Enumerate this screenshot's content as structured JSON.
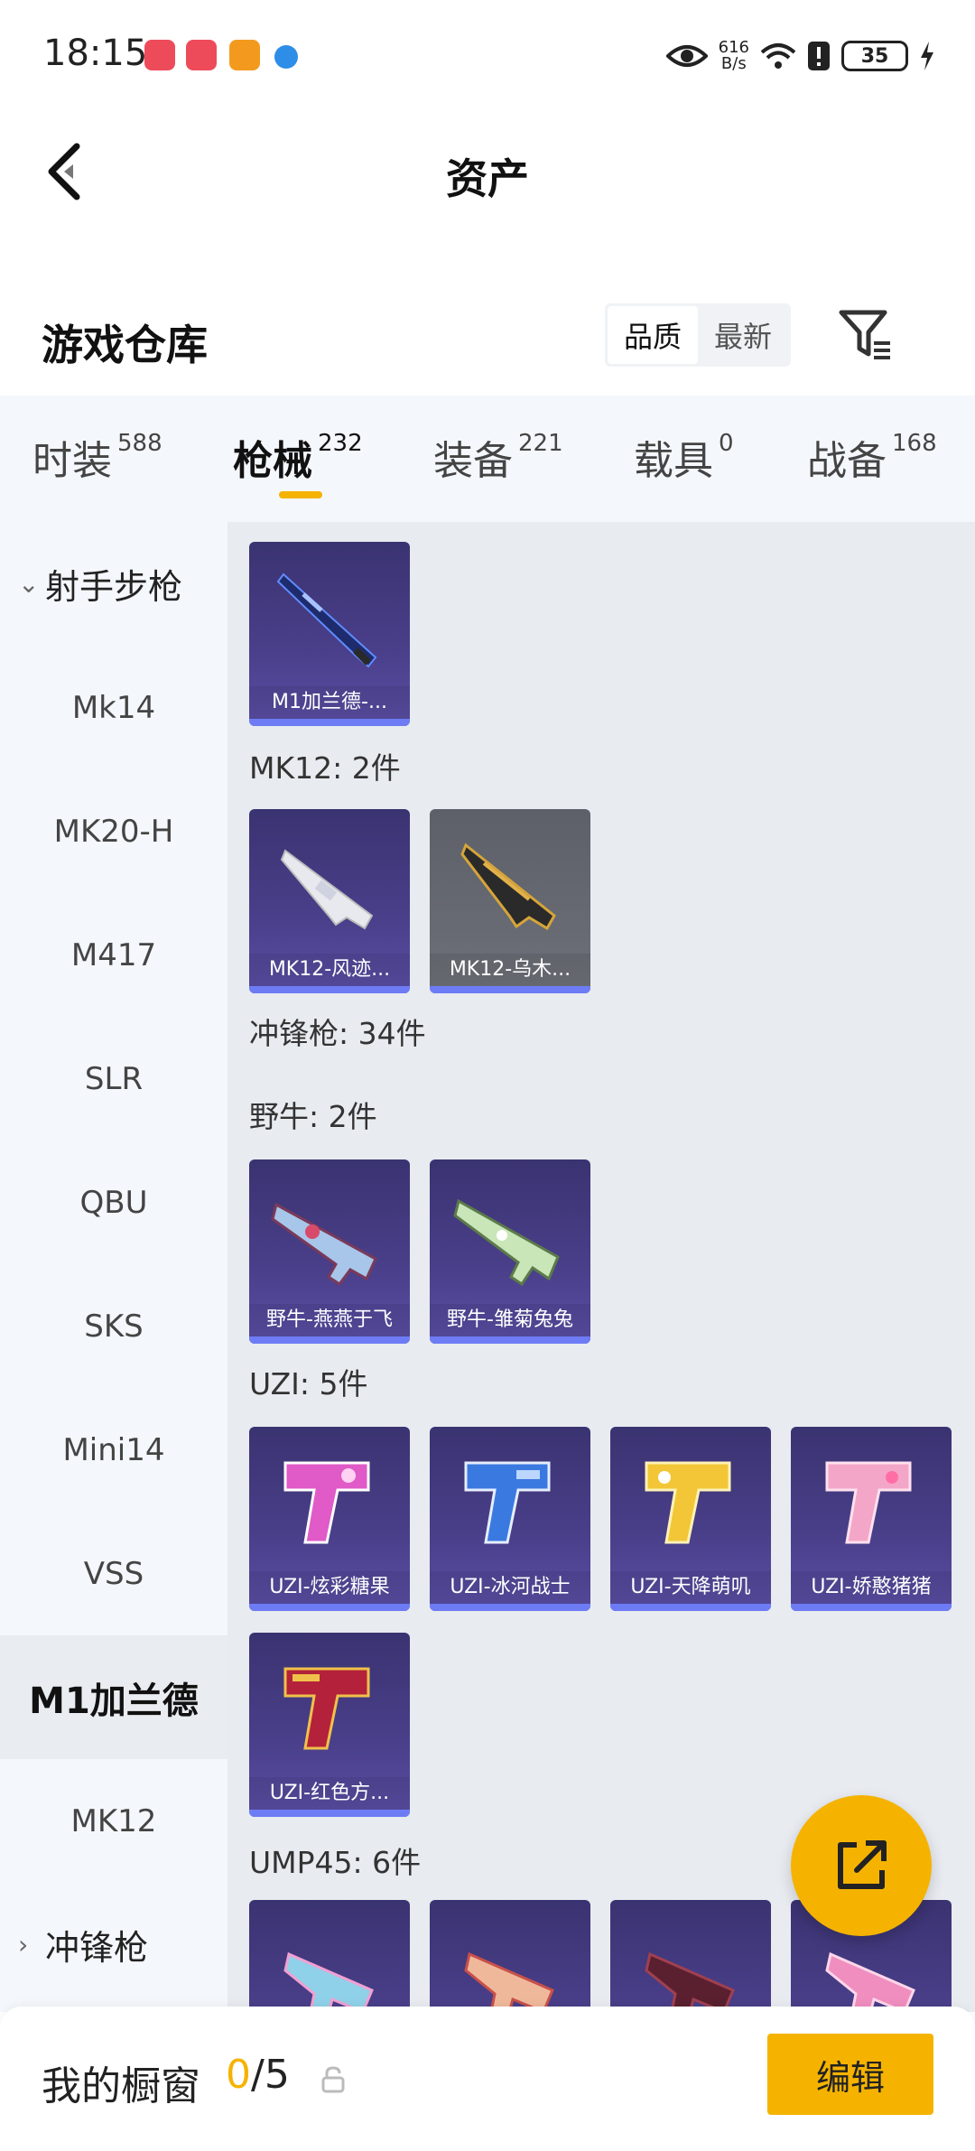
{
  "status_bar": {
    "time": "18:15",
    "net_speed_value": "616",
    "net_speed_unit": "B/s",
    "battery": "35"
  },
  "header": {
    "title": "资产"
  },
  "warehouse": {
    "title": "游戏仓库",
    "sort_options": [
      "品质",
      "最新"
    ],
    "active_sort": "品质"
  },
  "tabs": [
    {
      "label": "时装",
      "count": "588"
    },
    {
      "label": "枪械",
      "count": "232",
      "active": true
    },
    {
      "label": "装备",
      "count": "221"
    },
    {
      "label": "载具",
      "count": "0"
    },
    {
      "label": "战备",
      "count": "168"
    }
  ],
  "sidebar": {
    "group1": "射手步枪",
    "items": [
      "Mk14",
      "MK20-H",
      "M417",
      "SLR",
      "QBU",
      "SKS",
      "Mini14",
      "VSS",
      "M1加兰德",
      "MK12"
    ],
    "active": "M1加兰德",
    "group2": "冲锋枪"
  },
  "content": {
    "m1_items": [
      "M1加兰德-..."
    ],
    "mk12_label": "MK12: 2件",
    "mk12_items": [
      "MK12-风迹...",
      "MK12-乌木..."
    ],
    "smg_label": "冲锋枪: 34件",
    "bison_label": "野牛: 2件",
    "bison_items": [
      "野牛-燕燕于飞",
      "野牛-雏菊兔兔"
    ],
    "uzi_label": "UZI: 5件",
    "uzi_items": [
      "UZI-炫彩糖果",
      "UZI-冰河战士",
      "UZI-天降萌叽",
      "UZI-娇憨猪猪",
      "UZI-红色方..."
    ],
    "ump_label": "UMP45: 6件"
  },
  "bottom_bar": {
    "label": "我的橱窗",
    "used": "0",
    "total": "/5",
    "edit_label": "编辑"
  },
  "colors": {
    "accent": "#f5b300",
    "card_purple": "#4a3f8a",
    "card_gray": "#686b73",
    "page_bg": "#e8ebf0"
  }
}
